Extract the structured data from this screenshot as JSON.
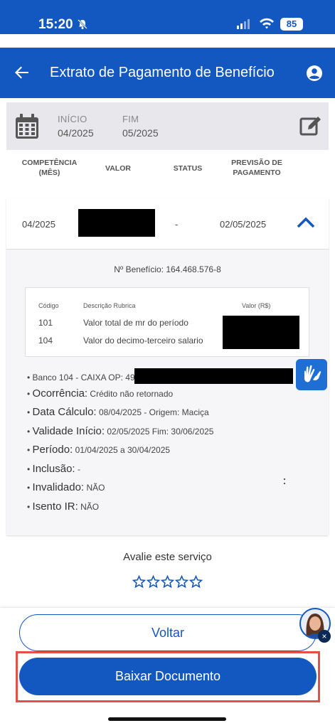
{
  "status_bar": {
    "time": "15:20",
    "battery": "85"
  },
  "header": {
    "title": "Extrato de Pagamento de Benefício"
  },
  "period": {
    "start_label": "INÍCIO",
    "start_value": "04/2025",
    "end_label": "FIM",
    "end_value": "05/2025"
  },
  "table": {
    "columns": [
      "COMPETÊNCIA\n(MÊS)",
      "VALOR",
      "STATUS",
      "PREVISÃO DE\nPAGAMENTO"
    ],
    "row": {
      "competencia": "04/2025",
      "status": "-",
      "previsao": "02/05/2025"
    }
  },
  "details": {
    "beneficio": "Nº Benefício: 164.468.576-8",
    "rubrica_headers": {
      "codigo": "Código",
      "descricao": "Descrição Rubrica",
      "valor": "Valor (R$)"
    },
    "rubricas": [
      {
        "codigo": "101",
        "descricao": "Valor total de mr do período"
      },
      {
        "codigo": "104",
        "descricao": "Valor do decimo-terceiro salario"
      }
    ],
    "banco": "• Banco 104 - CAIXA OP: 49",
    "fields": [
      {
        "label": "Ocorrência:",
        "value": "Crédito não retornado"
      },
      {
        "label": "Data Cálculo:",
        "value": "08/04/2025 - Origem: Maciça"
      },
      {
        "label": "Validade Início:",
        "value": "02/05/2025 Fim: 30/06/2025"
      },
      {
        "label": "Período:",
        "value": "01/04/2025 a 30/04/2025"
      },
      {
        "label": "Inclusão:",
        "value": "-"
      },
      {
        "label": "Invalidado:",
        "value": "NÃO"
      },
      {
        "label": "Isento IR:",
        "value": "NÃO"
      }
    ]
  },
  "rating": {
    "title": "Avalie este serviço",
    "stars_total": 5,
    "stars_filled": 0
  },
  "buttons": {
    "voltar": "Voltar",
    "baixar": "Baixar Documento"
  },
  "colors": {
    "primary": "#1357c0",
    "highlight": "#e25048"
  }
}
